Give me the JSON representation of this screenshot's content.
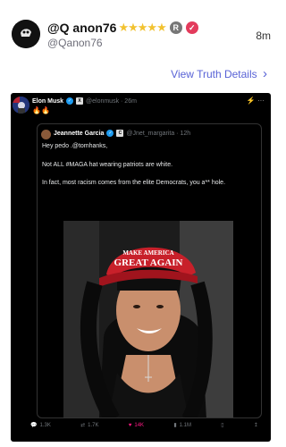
{
  "post": {
    "display_name": "@Q anon76",
    "stars": "★★★★★",
    "registered_mark": "R",
    "verified_mark": "✓",
    "handle": "@Qanon76",
    "time": "8m",
    "details_link": "View Truth Details",
    "details_arrow": "›"
  },
  "embedded": {
    "author_name": "Elon Musk",
    "author_handle": "@elonmusk · 26m",
    "badge": "X",
    "emoji": "🔥🔥",
    "top_icons": "⚡ ···",
    "quote": {
      "author_name": "Jeannette Garcia",
      "badge": "C",
      "author_handle": "@Jnet_margarita · 12h",
      "line1": "Hey pedo .@tomhanks,",
      "line2": "Not ALL #MAGA hat wearing patriots are white.",
      "line3": "In fact,  most racism comes from the elite Democrats, you a** hole.",
      "hat_text_1": "MAKE AMERICA",
      "hat_text_2": "GREAT AGAIN"
    },
    "stats": {
      "replies": "1.3K",
      "reposts": "1.7K",
      "likes": "14K",
      "views": "1.1M"
    }
  },
  "colors": {
    "link": "#5862d6",
    "star": "#f2c230",
    "verified": "#e33b5c",
    "x_background": "#000000",
    "like": "#f91880"
  }
}
